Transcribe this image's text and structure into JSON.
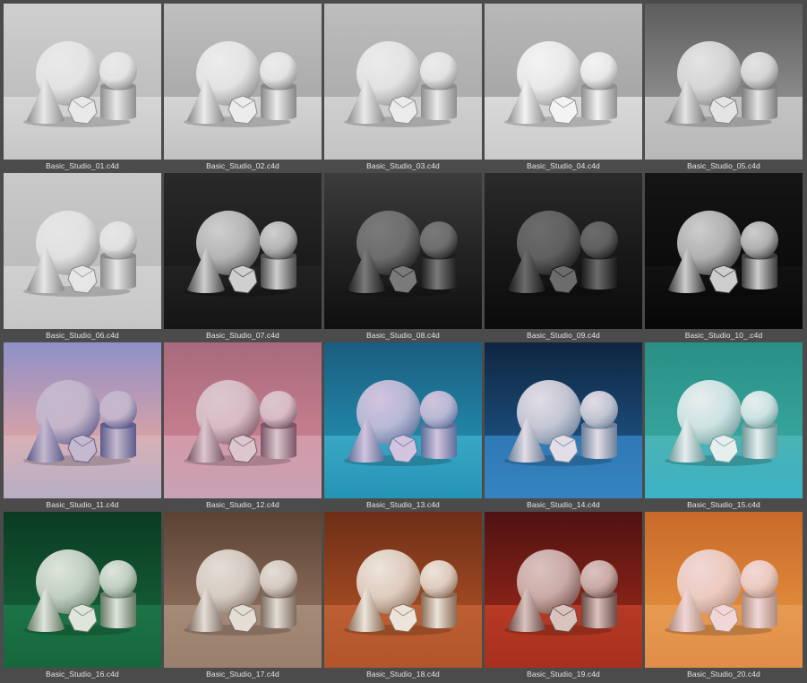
{
  "browser": {
    "items": [
      {
        "label": "Basic_Studio_01.c4d",
        "bg": [
          "#cfcfcf",
          "#bdbdbd",
          "#d6d6d6",
          "#c6c6c6"
        ],
        "obj": "#e9e9e9",
        "shade": "#8f8f8f"
      },
      {
        "label": "Basic_Studio_02.c4d",
        "bg": [
          "#bfbfbf",
          "#a9a9a9",
          "#d4d4d4",
          "#c2c2c2"
        ],
        "obj": "#ececec",
        "shade": "#888888"
      },
      {
        "label": "Basic_Studio_03.c4d",
        "bg": [
          "#bdbdbd",
          "#acacac",
          "#cfcfcf",
          "#c4c4c4"
        ],
        "obj": "#ebebeb",
        "shade": "#8d8d8d"
      },
      {
        "label": "Basic_Studio_04.c4d",
        "bg": [
          "#b8b8b8",
          "#a6a6a6",
          "#d9d9d9",
          "#cbcbcb"
        ],
        "obj": "#f3f3f3",
        "shade": "#8f8f8f"
      },
      {
        "label": "Basic_Studio_05.c4d",
        "bg": [
          "#5d5d5d",
          "#8d8d8d",
          "#c4c4c4",
          "#b8b8b8"
        ],
        "obj": "#e4e4e4",
        "shade": "#7d7d7d"
      },
      {
        "label": "Basic_Studio_06.c4d",
        "bg": [
          "#c9c9c9",
          "#bcbcbc",
          "#d0d0d0",
          "#c6c6c6"
        ],
        "obj": "#e6e6e6",
        "shade": "#8a8a8a"
      },
      {
        "label": "Basic_Studio_07.c4d",
        "bg": [
          "#2a2a2a",
          "#1a1a1a",
          "#222222",
          "#151515"
        ],
        "obj": "#cfcfcf",
        "shade": "#4c4c4c"
      },
      {
        "label": "Basic_Studio_08.c4d",
        "bg": [
          "#3c3c3c",
          "#1d1d1d",
          "#202020",
          "#0f0f0f"
        ],
        "obj": "#7a7a7a",
        "shade": "#1e1e1e"
      },
      {
        "label": "Basic_Studio_09.c4d",
        "bg": [
          "#2b2b2b",
          "#141414",
          "#161616",
          "#0b0b0b"
        ],
        "obj": "#6c6c6c",
        "shade": "#1a1a1a"
      },
      {
        "label": "Basic_Studio_10_.c4d",
        "bg": [
          "#151515",
          "#0b0b0b",
          "#121212",
          "#070707"
        ],
        "obj": "#cdcdcd",
        "shade": "#3b3b3b"
      },
      {
        "label": "Basic_Studio_11.c4d",
        "bg": [
          "#8f90c9",
          "#d9a2a6",
          "#d8b0b6",
          "#b7aec4"
        ],
        "obj": "#c5b9cf",
        "shade": "#5d5c8c"
      },
      {
        "label": "Basic_Studio_12.c4d",
        "bg": [
          "#a86a7c",
          "#c77f8f",
          "#d49aa8",
          "#c7a2b5"
        ],
        "obj": "#dcc7cf",
        "shade": "#7a5566"
      },
      {
        "label": "Basic_Studio_13.c4d",
        "bg": [
          "#1a5d80",
          "#2388a8",
          "#39a6c4",
          "#2594b6"
        ],
        "obj": "#d2c4de",
        "shade": "#5b6f99"
      },
      {
        "label": "Basic_Studio_14.c4d",
        "bg": [
          "#0f2640",
          "#1b4d7b",
          "#2f79b6",
          "#3483bf"
        ],
        "obj": "#e2dde6",
        "shade": "#6c7f98"
      },
      {
        "label": "Basic_Studio_15.c4d",
        "bg": [
          "#2a8f86",
          "#36a59c",
          "#4bb3b3",
          "#3bb2c5"
        ],
        "obj": "#e7eeee",
        "shade": "#6c9a9a"
      },
      {
        "label": "Basic_Studio_16.c4d",
        "bg": [
          "#0b3b22",
          "#135b35",
          "#1c7446",
          "#16673c"
        ],
        "obj": "#dfe5dc",
        "shade": "#667a65"
      },
      {
        "label": "Basic_Studio_17.c4d",
        "bg": [
          "#5b4334",
          "#8a6b59",
          "#a58a78",
          "#9a7f6d"
        ],
        "obj": "#e4ddd6",
        "shade": "#7c6b5f"
      },
      {
        "label": "Basic_Studio_18.c4d",
        "bg": [
          "#6d2f17",
          "#a24a22",
          "#bd5f33",
          "#b2552b"
        ],
        "obj": "#ece4da",
        "shade": "#8a6a55"
      },
      {
        "label": "Basic_Studio_19.c4d",
        "bg": [
          "#4f1212",
          "#8b2418",
          "#b63a25",
          "#a8301d"
        ],
        "obj": "#d9c3bf",
        "shade": "#6d4b46"
      },
      {
        "label": "Basic_Studio_20.c4d",
        "bg": [
          "#c86a2b",
          "#e08a3a",
          "#e79a52",
          "#e08d47"
        ],
        "obj": "#f0d7d7",
        "shade": "#b08a7a"
      }
    ]
  }
}
